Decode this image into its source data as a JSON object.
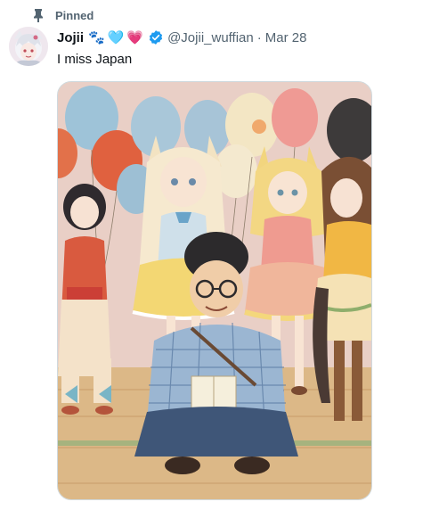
{
  "pinned": {
    "label": "Pinned",
    "icon": "pin-icon"
  },
  "author": {
    "display_name": "Jojii",
    "emojis": [
      "🐾",
      "🩵",
      "💗"
    ],
    "verified_icon": "verified-badge-icon",
    "handle": "@Jojii_wuffian",
    "separator": "·",
    "date": "Mar 28"
  },
  "tweet": {
    "text": "I miss Japan"
  },
  "media": {
    "kind": "illustration",
    "icon": "anime-party-illustration"
  },
  "colors": {
    "text_primary": "#0f1419",
    "text_secondary": "#536471",
    "verified_blue": "#1d9bf0",
    "border": "#cfd9de"
  }
}
